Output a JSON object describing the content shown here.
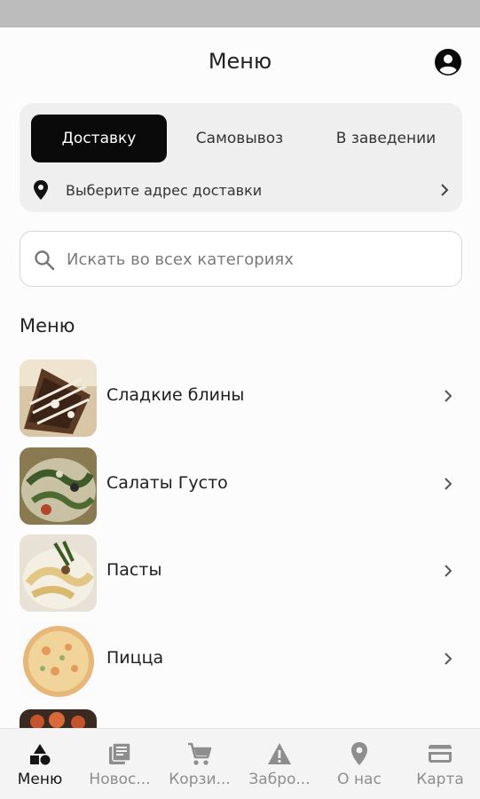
{
  "header": {
    "title": "Меню",
    "profile_icon": "account-circle-icon"
  },
  "delivery_modes": {
    "tabs": [
      {
        "label": "Доставку",
        "active": true
      },
      {
        "label": "Самовывоз",
        "active": false
      },
      {
        "label": "В заведении",
        "active": false
      }
    ],
    "address_placeholder": "Выберите адрес доставки"
  },
  "search": {
    "placeholder": "Искать во всех категориях",
    "value": ""
  },
  "menu_section": {
    "title": "Меню",
    "categories": [
      {
        "label": "Сладкие блины"
      },
      {
        "label": "Салаты Густо"
      },
      {
        "label": "Пасты"
      },
      {
        "label": "Пицца"
      },
      {
        "label": ""
      }
    ]
  },
  "bottom_nav": [
    {
      "label": "Меню",
      "icon": "shapes-icon",
      "active": true
    },
    {
      "label": "Новос...",
      "icon": "news-icon",
      "active": false
    },
    {
      "label": "Корзи...",
      "icon": "cart-icon",
      "active": false
    },
    {
      "label": "Забро...",
      "icon": "warning-icon",
      "active": false
    },
    {
      "label": "О нас",
      "icon": "location-pin-icon",
      "active": false
    },
    {
      "label": "Карта",
      "icon": "credit-card-icon",
      "active": false
    }
  ],
  "colors": {
    "active_tab_bg": "#0a0a0a",
    "card_bg": "#efefef",
    "nav_inactive": "#8e8e8e"
  }
}
